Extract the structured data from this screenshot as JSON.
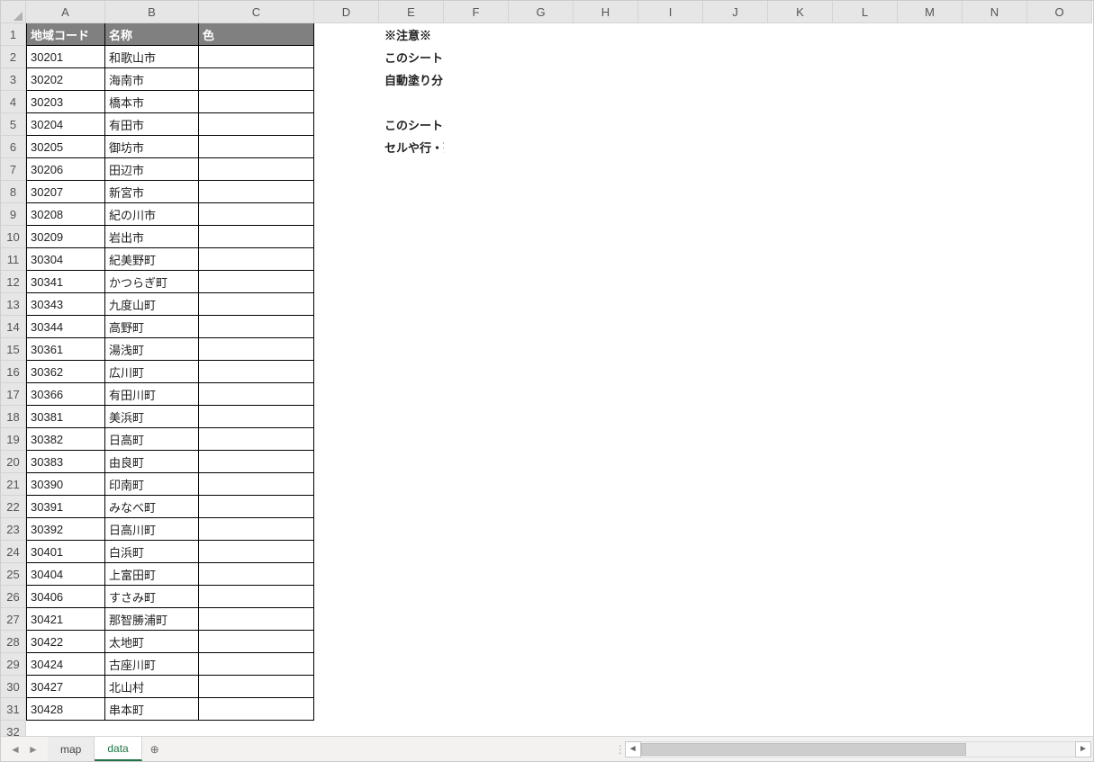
{
  "columns": [
    "A",
    "B",
    "C",
    "D",
    "E",
    "F",
    "G",
    "H",
    "I",
    "J",
    "K",
    "L",
    "M",
    "N",
    "O"
  ],
  "headers": {
    "code": "地域コード",
    "name": "名称",
    "color": "色"
  },
  "rows": [
    {
      "code": "30201",
      "name": "和歌山市"
    },
    {
      "code": "30202",
      "name": "海南市"
    },
    {
      "code": "30203",
      "name": "橋本市"
    },
    {
      "code": "30204",
      "name": "有田市"
    },
    {
      "code": "30205",
      "name": "御坊市"
    },
    {
      "code": "30206",
      "name": "田辺市"
    },
    {
      "code": "30207",
      "name": "新宮市"
    },
    {
      "code": "30208",
      "name": "紀の川市"
    },
    {
      "code": "30209",
      "name": "岩出市"
    },
    {
      "code": "30304",
      "name": "紀美野町"
    },
    {
      "code": "30341",
      "name": "かつらぎ町"
    },
    {
      "code": "30343",
      "name": "九度山町"
    },
    {
      "code": "30344",
      "name": "高野町"
    },
    {
      "code": "30361",
      "name": "湯浅町"
    },
    {
      "code": "30362",
      "name": "広川町"
    },
    {
      "code": "30366",
      "name": "有田川町"
    },
    {
      "code": "30381",
      "name": "美浜町"
    },
    {
      "code": "30382",
      "name": "日高町"
    },
    {
      "code": "30383",
      "name": "由良町"
    },
    {
      "code": "30390",
      "name": "印南町"
    },
    {
      "code": "30391",
      "name": "みなべ町"
    },
    {
      "code": "30392",
      "name": "日高川町"
    },
    {
      "code": "30401",
      "name": "白浜町"
    },
    {
      "code": "30404",
      "name": "上富田町"
    },
    {
      "code": "30406",
      "name": "すさみ町"
    },
    {
      "code": "30421",
      "name": "那智勝浦町"
    },
    {
      "code": "30422",
      "name": "太地町"
    },
    {
      "code": "30424",
      "name": "古座川町"
    },
    {
      "code": "30427",
      "name": "北山村"
    },
    {
      "code": "30428",
      "name": "串本町"
    }
  ],
  "notes": {
    "e1": "※注意※",
    "e2": "このシートはマクロを利用した自動塗り分けで使用します。",
    "e3": "自動塗り分けのマクロについては添付の資料をご覧ください。",
    "e5": "このシートのセルを移動・追加・削除したり、行や列を追加・削除した場合、マクロが動作しない恐れがあります。",
    "e6": "セルや行・列の追加や削除などは行わないでください。"
  },
  "tabs": {
    "map": "map",
    "data": "data"
  },
  "nav": {
    "prev": "◄",
    "next": "►",
    "add": "⊕",
    "scrollLeft": "◄",
    "scrollRight": "►"
  },
  "totalRows": 32,
  "headerColE": 5
}
